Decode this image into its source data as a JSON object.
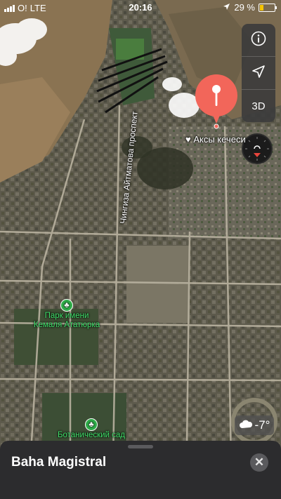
{
  "status_bar": {
    "carrier": "O!",
    "network": "LTE",
    "time": "20:16",
    "battery_percent": "29 %",
    "battery_level": 0.29,
    "battery_color": "#f5c400",
    "icons": [
      "signal-bars-icon",
      "location-arrow-icon",
      "battery-icon"
    ]
  },
  "map": {
    "controls": [
      {
        "name": "info-button",
        "icon": "info-icon",
        "label": ""
      },
      {
        "name": "location-button",
        "icon": "location-arrow-icon",
        "label": ""
      },
      {
        "name": "3d-button",
        "icon": "",
        "label": "3D"
      }
    ],
    "pin_color": "#f2665a",
    "place_label": "Аксы кечеси",
    "street_label": "Чингиза Айтматова проспект",
    "pois": [
      {
        "name": "poi-park",
        "icon": "tree-icon",
        "label_line1": "Парк имени",
        "label_line2": "Кемаля Ататюрка"
      },
      {
        "name": "poi-botanical",
        "icon": "tree-icon",
        "label_line1": "Ботанический сад",
        "label_line2": ""
      }
    ],
    "poi_color": "#40e06a",
    "weather": {
      "temperature": "-7°",
      "icon": "cloud-icon"
    }
  },
  "sheet": {
    "title": "Baha Magistral",
    "close_icon": "close-icon"
  }
}
